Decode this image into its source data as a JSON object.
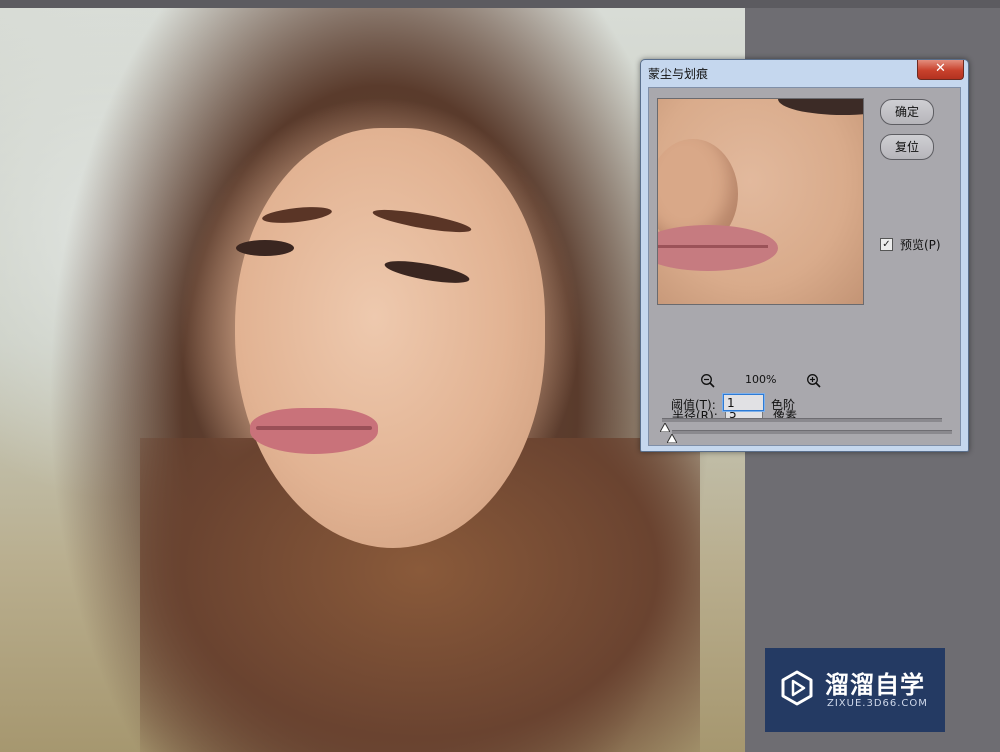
{
  "dialog": {
    "title": "蒙尘与划痕",
    "close_glyph": "✕",
    "ok_label": "确定",
    "reset_label": "复位",
    "preview_label": "预览(P)",
    "preview_checked": true,
    "zoom_level": "100%",
    "radius": {
      "label": "半径(R):",
      "value": "5",
      "unit": "像素"
    },
    "threshold": {
      "label": "阈值(T):",
      "value": "1",
      "unit": "色阶"
    }
  },
  "icons": {
    "zoom_out": "zoom-out-icon",
    "zoom_in": "zoom-in-icon",
    "checkbox": "checkmark-icon",
    "logo": "play-logo-icon"
  },
  "watermark": {
    "title": "溜溜自学",
    "url": "ZIXUE.3D66.COM"
  },
  "colors": {
    "workspace_bg": "#6e6d72",
    "dialog_frame": "#c5d7ee",
    "panel_bg": "#a9a8ad",
    "close_red": "#c8412c",
    "watermark_bg": "#243a63"
  }
}
